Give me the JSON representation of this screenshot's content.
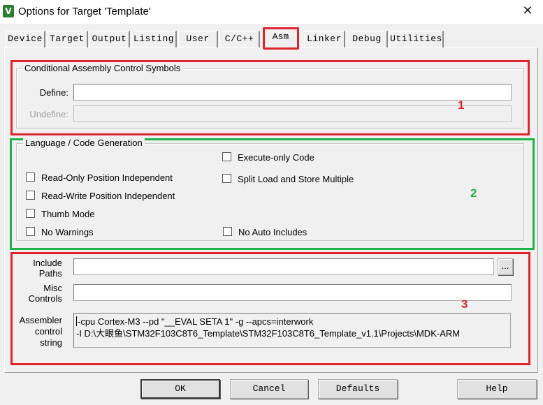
{
  "window": {
    "title": "Options for Target 'Template'",
    "icon": "keil-uvision-icon",
    "close_glyph": "✕"
  },
  "tabs": [
    {
      "label": "Device"
    },
    {
      "label": "Target"
    },
    {
      "label": "Output"
    },
    {
      "label": "Listing"
    },
    {
      "label": "User"
    },
    {
      "label": "C/C++"
    },
    {
      "label": "Asm",
      "active": true
    },
    {
      "label": "Linker"
    },
    {
      "label": "Debug"
    },
    {
      "label": "Utilities"
    }
  ],
  "conditional": {
    "title": "Conditional Assembly Control Symbols",
    "define_label": "Define:",
    "define_value": "",
    "undefine_label": "Undefine:",
    "undefine_value": ""
  },
  "language": {
    "title": "Language / Code Generation",
    "options": {
      "execute_only": {
        "label": "Execute-only Code",
        "checked": false
      },
      "ropi": {
        "label": "Read-Only Position Independent",
        "checked": false
      },
      "split_ldm": {
        "label": "Split Load and Store Multiple",
        "checked": false
      },
      "rwpi": {
        "label": "Read-Write Position Independent",
        "checked": false
      },
      "thumb": {
        "label": "Thumb Mode",
        "checked": false
      },
      "no_warnings": {
        "label": "No Warnings",
        "checked": false
      },
      "no_auto_includes": {
        "label": "No Auto Includes",
        "checked": false
      }
    }
  },
  "paths": {
    "include_label_1": "Include",
    "include_label_2": "Paths",
    "include_value": "",
    "browse_label": "...",
    "misc_label_1": "Misc",
    "misc_label_2": "Controls",
    "misc_value": "",
    "asm_label_1": "Assembler",
    "asm_label_2": "control",
    "asm_label_3": "string",
    "asm_line_1": "-cpu Cortex-M3 --pd \"__EVAL SETA 1\" -g --apcs=interwork",
    "asm_line_2": "-I D:\\大眼鱼\\STM32F103C8T6_Template\\STM32F103C8T6_Template_v1.1\\Projects\\MDK-ARM"
  },
  "annotations": {
    "box1": "1",
    "box2": "2",
    "box3": "3",
    "red": "#e0242e",
    "green": "#22b14c"
  },
  "buttons": {
    "ok": "OK",
    "cancel": "Cancel",
    "defaults": "Defaults",
    "help": "Help"
  }
}
